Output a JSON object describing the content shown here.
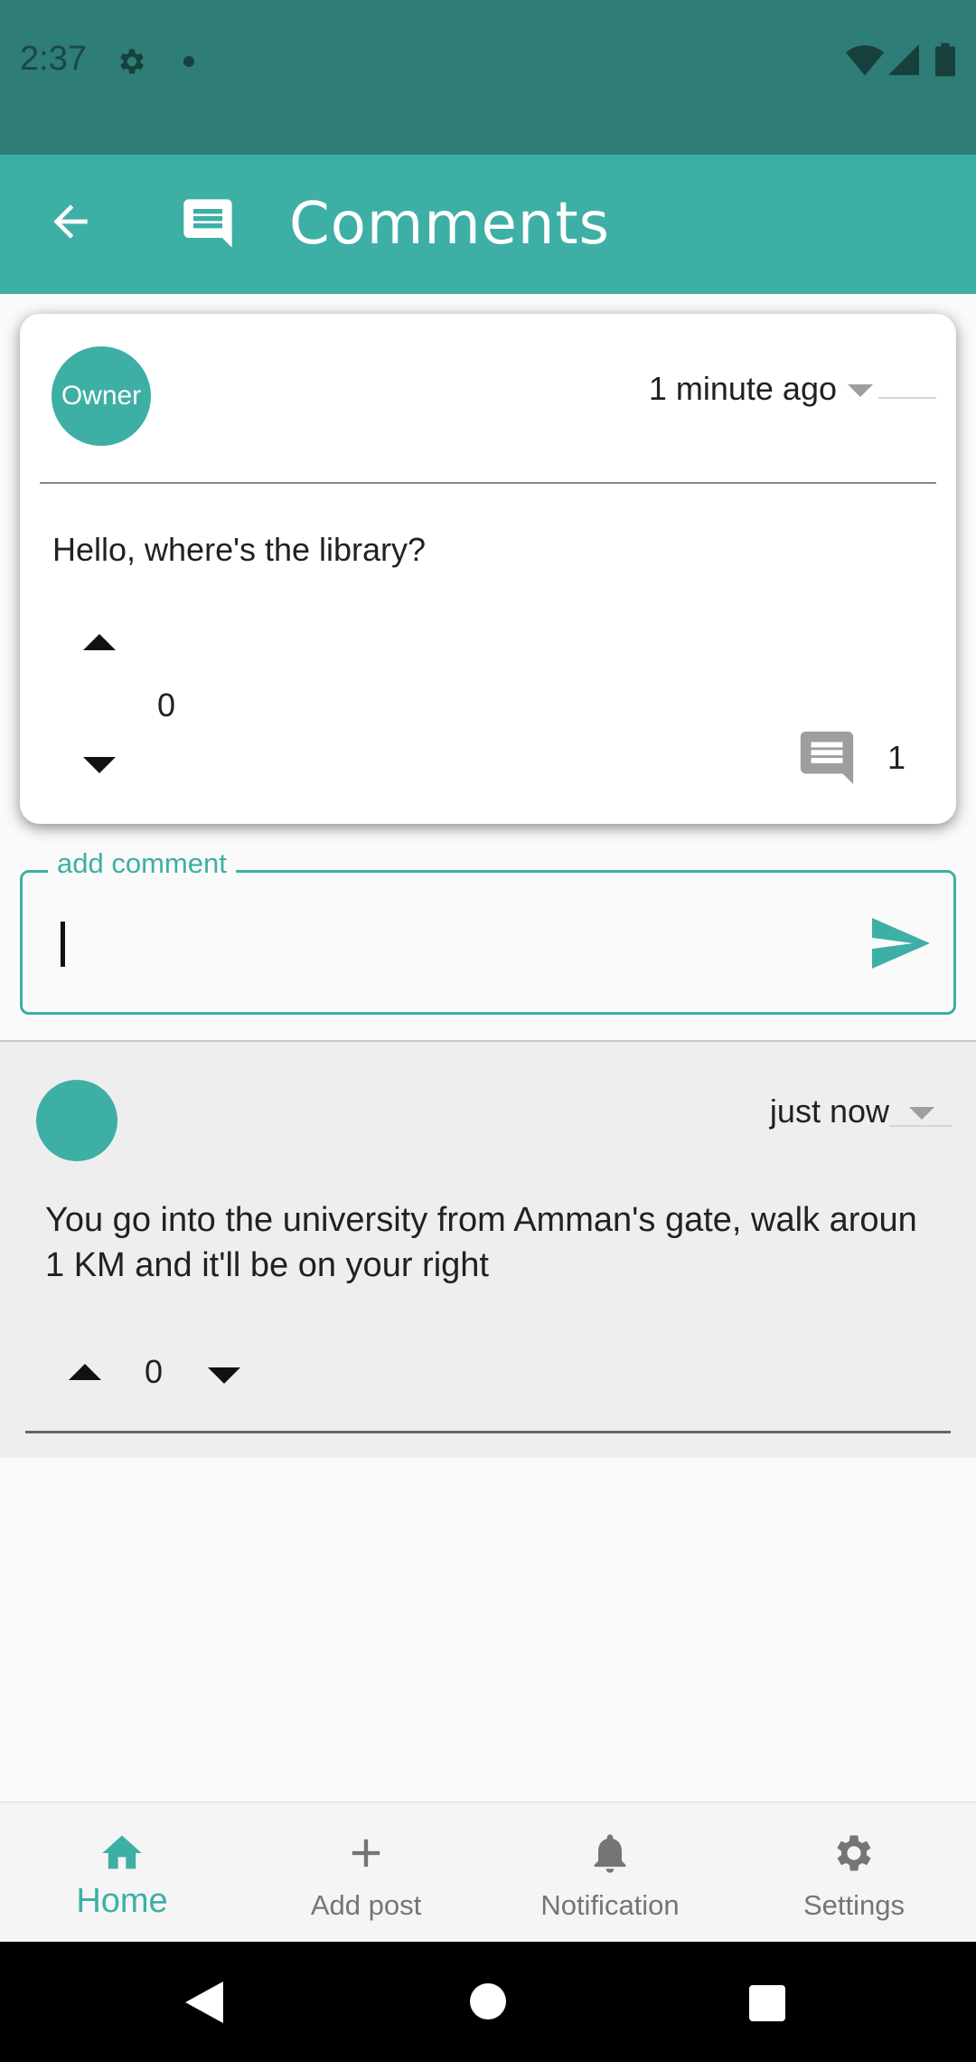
{
  "status_bar": {
    "time": "2:37"
  },
  "app_bar": {
    "title": "Comments"
  },
  "post": {
    "author_avatar_label": "Owner",
    "timestamp": "1 minute ago",
    "text": "Hello, where's the library?",
    "votes": "0",
    "comment_count": "1"
  },
  "comment_input": {
    "label": "add comment",
    "value": ""
  },
  "replies": [
    {
      "timestamp": "just now",
      "text": "You go into the university from Amman's gate, walk aroun 1 KM and it'll be on your right",
      "votes": "0"
    }
  ],
  "bottom_nav": {
    "items": [
      {
        "label": "Home",
        "icon": "home-icon",
        "active": true
      },
      {
        "label": "Add post",
        "icon": "plus-icon",
        "active": false
      },
      {
        "label": "Notification",
        "icon": "bell-icon",
        "active": false
      },
      {
        "label": "Settings",
        "icon": "gear-icon",
        "active": false
      }
    ]
  },
  "colors": {
    "accent": "#3eafa5",
    "status_bar": "#2e7d76"
  }
}
